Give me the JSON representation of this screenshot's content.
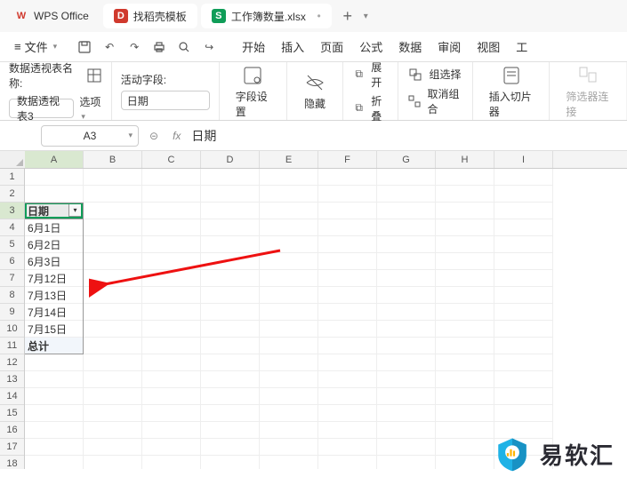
{
  "tabs": {
    "office": "WPS Office",
    "template": "找稻壳模板",
    "file": "工作簿数量.xlsx"
  },
  "menubar": {
    "file": "文件",
    "menus": [
      "开始",
      "插入",
      "页面",
      "公式",
      "数据",
      "审阅",
      "视图",
      "工"
    ]
  },
  "ribbon": {
    "pivotname_label": "数据透视表名称:",
    "pivotname_value": "数据透视表3",
    "options": "选项",
    "activefield_label": "活动字段:",
    "activefield_value": "日期",
    "fieldset": "字段设置",
    "hide": "隐藏",
    "expand": "展开",
    "collapse": "折叠",
    "group_sel": "组选择",
    "ungroup": "取消组合",
    "slicer": "插入切片器",
    "filter_conn": "筛选器连接"
  },
  "fx": {
    "cellref": "A3",
    "value": "日期",
    "fx": "fx"
  },
  "cols": [
    "A",
    "B",
    "C",
    "D",
    "E",
    "F",
    "G",
    "H",
    "I"
  ],
  "rows_n": 18,
  "pivot": {
    "header": "日期",
    "items": [
      "6月1日",
      "6月2日",
      "6月3日",
      "7月12日",
      "7月13日",
      "7月14日",
      "7月15日"
    ],
    "total": "总计"
  },
  "watermark": "易软汇"
}
